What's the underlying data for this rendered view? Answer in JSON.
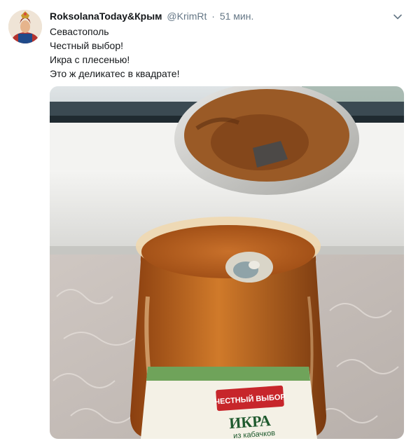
{
  "tweet": {
    "display_name": "RoksolanaToday&Крым",
    "handle": "@KrimRt",
    "separator": "·",
    "time": "51 мин.",
    "text_lines": [
      "Севастополь",
      "Честный выбор!",
      "Икра с плесенью!",
      "Это ж деликатес в квадрате!"
    ]
  },
  "photo": {
    "jar_label_brand": "ЧЕСТНЫЙ ВЫБОР",
    "jar_label_product": "ИКРА",
    "jar_label_sub": "из кабачков"
  },
  "colors": {
    "text_primary": "#14171a",
    "text_secondary": "#657786",
    "caret": "#657786"
  },
  "icons": {
    "caret": "chevron-down-icon",
    "avatar": "avatar"
  }
}
